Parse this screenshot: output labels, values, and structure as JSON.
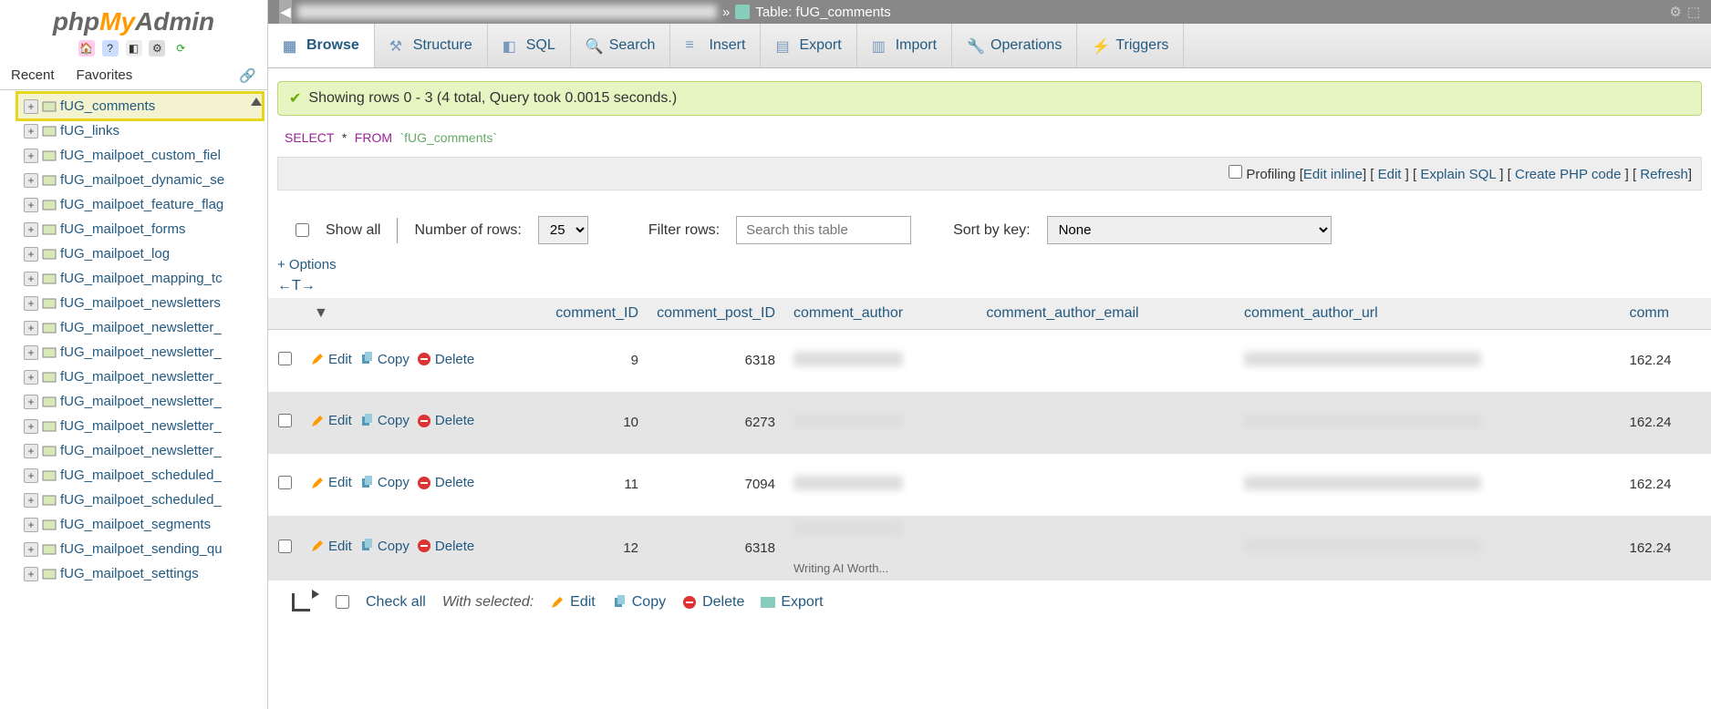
{
  "logo": {
    "p1": "php",
    "p2": "My",
    "p3": "Admin"
  },
  "sidebar": {
    "mini_icons": [
      "home-icon",
      "help-icon",
      "sql-icon",
      "gear-icon",
      "refresh-icon"
    ],
    "tabs": {
      "recent": "Recent",
      "favorites": "Favorites"
    },
    "tree": [
      {
        "label": "fUG_comments",
        "selected": true
      },
      {
        "label": "fUG_links"
      },
      {
        "label": "fUG_mailpoet_custom_fiel"
      },
      {
        "label": "fUG_mailpoet_dynamic_se"
      },
      {
        "label": "fUG_mailpoet_feature_flag"
      },
      {
        "label": "fUG_mailpoet_forms"
      },
      {
        "label": "fUG_mailpoet_log"
      },
      {
        "label": "fUG_mailpoet_mapping_tc"
      },
      {
        "label": "fUG_mailpoet_newsletters"
      },
      {
        "label": "fUG_mailpoet_newsletter_"
      },
      {
        "label": "fUG_mailpoet_newsletter_"
      },
      {
        "label": "fUG_mailpoet_newsletter_"
      },
      {
        "label": "fUG_mailpoet_newsletter_"
      },
      {
        "label": "fUG_mailpoet_newsletter_"
      },
      {
        "label": "fUG_mailpoet_newsletter_"
      },
      {
        "label": "fUG_mailpoet_scheduled_"
      },
      {
        "label": "fUG_mailpoet_scheduled_"
      },
      {
        "label": "fUG_mailpoet_segments"
      },
      {
        "label": "fUG_mailpoet_sending_qu"
      },
      {
        "label": "fUG_mailpoet_settings"
      }
    ]
  },
  "crumb": {
    "prefix": "»",
    "table_label": "Table: fUG_comments"
  },
  "topnav": [
    {
      "label": "Browse",
      "icon": "browse",
      "active": true
    },
    {
      "label": "Structure",
      "icon": "structure"
    },
    {
      "label": "SQL",
      "icon": "sql"
    },
    {
      "label": "Search",
      "icon": "search"
    },
    {
      "label": "Insert",
      "icon": "insert"
    },
    {
      "label": "Export",
      "icon": "export"
    },
    {
      "label": "Import",
      "icon": "import"
    },
    {
      "label": "Operations",
      "icon": "operations"
    },
    {
      "label": "Triggers",
      "icon": "triggers"
    }
  ],
  "status": "Showing rows 0 - 3 (4 total, Query took 0.0015 seconds.)",
  "query": {
    "select": "SELECT",
    "star": "*",
    "from": "FROM",
    "table": "`fUG_comments`"
  },
  "querylinks": {
    "profiling": "Profiling",
    "edit_inline": "Edit inline",
    "edit": "Edit",
    "explain": "Explain SQL",
    "create_php": "Create PHP code",
    "refresh": "Refresh"
  },
  "filterbar": {
    "show_all": "Show all",
    "num_rows_label": "Number of rows:",
    "num_rows_value": "25",
    "filter_label": "Filter rows:",
    "filter_placeholder": "Search this table",
    "sort_label": "Sort by key:",
    "sort_value": "None"
  },
  "options": "+ Options",
  "ctrls": "←T→",
  "columns": [
    "",
    "",
    "comment_ID",
    "comment_post_ID",
    "comment_author",
    "comment_author_email",
    "comment_author_url",
    "comm"
  ],
  "action_labels": {
    "edit": "Edit",
    "copy": "Copy",
    "delete": "Delete"
  },
  "rows": [
    {
      "id": "9",
      "post_id": "6318",
      "ip": "162.24"
    },
    {
      "id": "10",
      "post_id": "6273",
      "ip": "162.24"
    },
    {
      "id": "11",
      "post_id": "7094",
      "ip": "162.24"
    },
    {
      "id": "12",
      "post_id": "6318",
      "ip": "162.24"
    }
  ],
  "footer": {
    "check_all": "Check all",
    "with_selected": "With selected:",
    "edit": "Edit",
    "copy": "Copy",
    "delete": "Delete",
    "export": "Export"
  },
  "extra_text": "Writing AI Worth..."
}
